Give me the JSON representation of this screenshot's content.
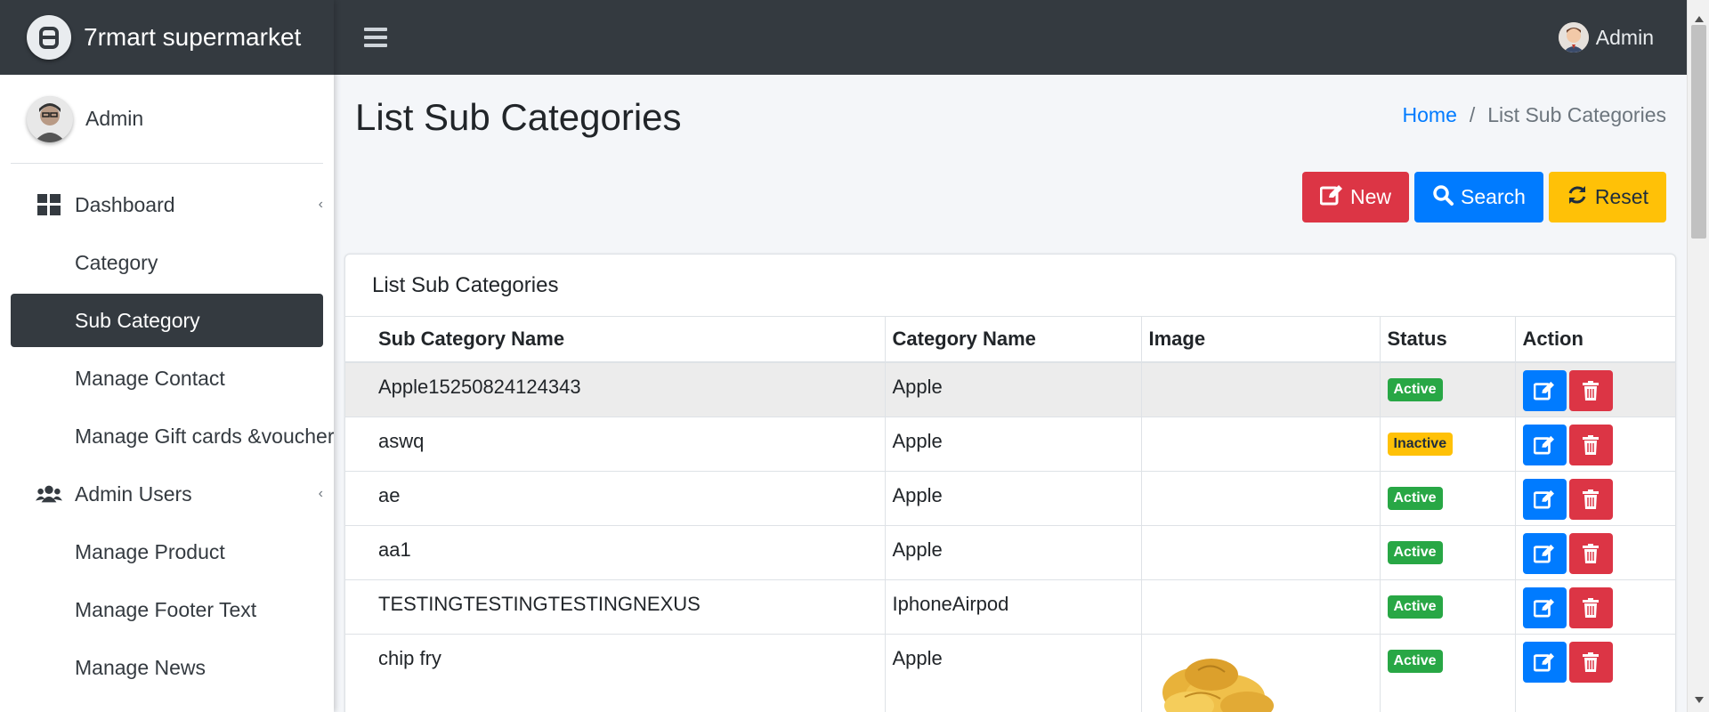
{
  "brand": {
    "name": "7rmart supermarket"
  },
  "sidebar": {
    "user_name": "Admin",
    "items": [
      {
        "label": "Dashboard",
        "icon": "dashboard-icon",
        "has_caret": true
      },
      {
        "label": "Category"
      },
      {
        "label": "Sub Category",
        "active": true
      },
      {
        "label": "Manage Contact"
      },
      {
        "label": "Manage Gift cards &voucher"
      },
      {
        "label": "Admin Users",
        "icon": "users-icon",
        "has_caret": true
      },
      {
        "label": "Manage Product"
      },
      {
        "label": "Manage Footer Text"
      },
      {
        "label": "Manage News"
      }
    ]
  },
  "header": {
    "user_name": "Admin"
  },
  "page": {
    "title": "List Sub Categories",
    "breadcrumb": {
      "home": "Home",
      "separator": "/",
      "current": "List Sub Categories"
    }
  },
  "toolbar": {
    "new_label": "New",
    "search_label": "Search",
    "reset_label": "Reset"
  },
  "table": {
    "card_title": "List Sub Categories",
    "columns": [
      "Sub Category Name",
      "Category Name",
      "Image",
      "Status",
      "Action"
    ],
    "rows": [
      {
        "sub_category": "Apple15250824124343",
        "category": "Apple",
        "image": "",
        "status": "Active"
      },
      {
        "sub_category": "aswq",
        "category": "Apple",
        "image": "",
        "status": "Inactive"
      },
      {
        "sub_category": "ae",
        "category": "Apple",
        "image": "",
        "status": "Active"
      },
      {
        "sub_category": "aa1",
        "category": "Apple",
        "image": "",
        "status": "Active"
      },
      {
        "sub_category": "TESTINGTESTINGTESTINGNEXUS",
        "category": "IphoneAirpod",
        "image": "",
        "status": "Active"
      },
      {
        "sub_category": "chip fry",
        "category": "Apple",
        "image": "chips",
        "status": "Active"
      }
    ]
  },
  "colors": {
    "dark": "#343a40",
    "primary": "#007bff",
    "danger": "#dc3545",
    "warning": "#ffc107",
    "success": "#28a745"
  }
}
